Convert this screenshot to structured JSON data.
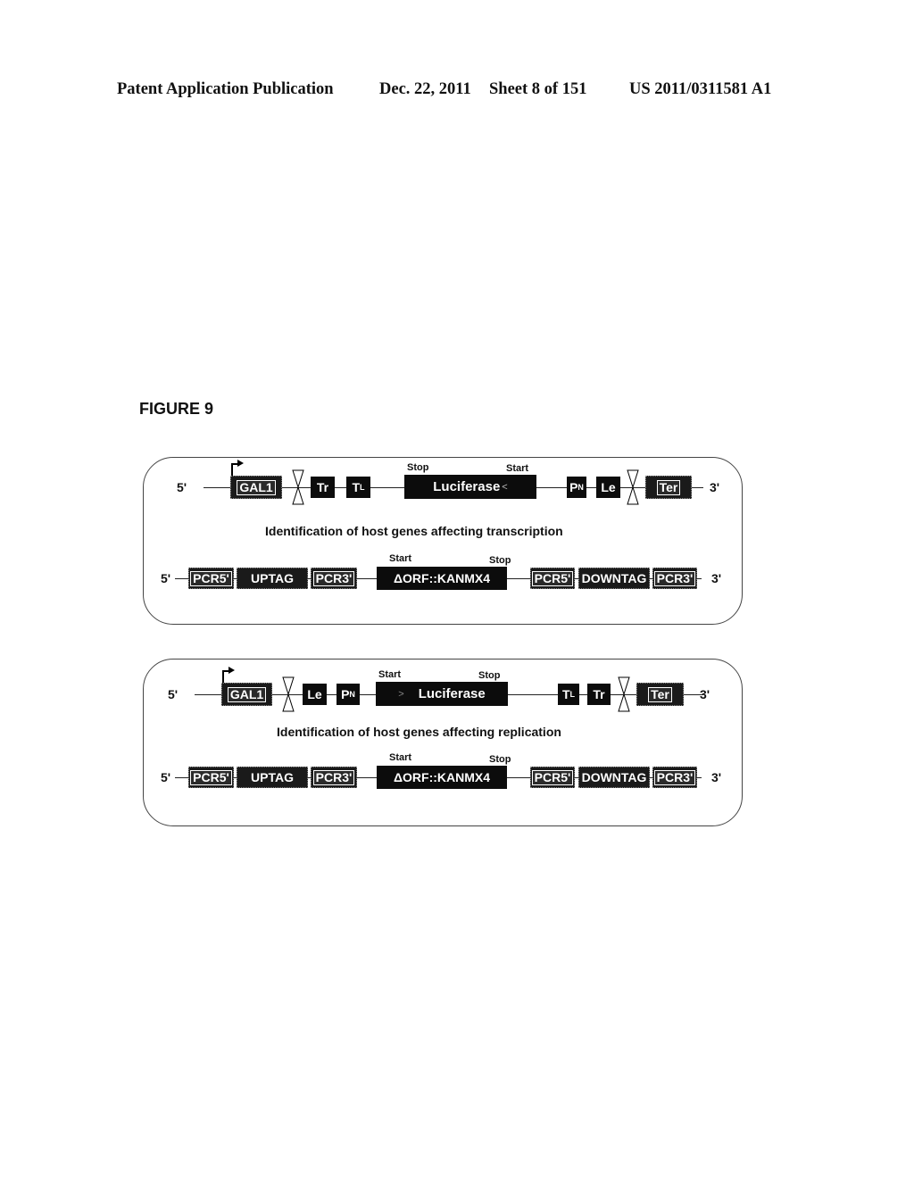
{
  "header": {
    "publication": "Patent Application Publication",
    "date": "Dec. 22, 2011",
    "sheet": "Sheet 8 of 151",
    "number": "US 2011/0311581 A1"
  },
  "figure": {
    "title": "FIGURE 9"
  },
  "panels": [
    {
      "caption": "Identification of host genes affecting transcription",
      "construct": {
        "five_prime": "5'",
        "three_prime": "3'",
        "promoter": "GAL1",
        "elements": [
          "Tr",
          "T",
          "Luciferase",
          "P",
          "Le",
          "Ter"
        ],
        "tl_sub": "L",
        "pn_sub": "N",
        "luciferase_start": "Start",
        "luciferase_stop": "Stop",
        "luciferase_arrow": "<"
      },
      "deletion": {
        "five_prime": "5'",
        "three_prime": "3'",
        "elements": [
          "PCR5'",
          "UPTAG",
          "PCR3'",
          "ΔORF::KANMX4",
          "PCR5'",
          "DOWNTAG",
          "PCR3'"
        ],
        "orf_start": "Start",
        "orf_stop": "Stop"
      }
    },
    {
      "caption": "Identification of host genes affecting replication",
      "construct": {
        "five_prime": "5'",
        "three_prime": "3'",
        "promoter": "GAL1",
        "elements": [
          "Le",
          "P",
          "Luciferase",
          "T",
          "Tr",
          "Ter"
        ],
        "tl_sub": "L",
        "pn_sub": "N",
        "luciferase_start": "Start",
        "luciferase_stop": "Stop",
        "luciferase_arrow": ">"
      },
      "deletion": {
        "five_prime": "5'",
        "three_prime": "3'",
        "elements": [
          "PCR5'",
          "UPTAG",
          "PCR3'",
          "ΔORF::KANMX4",
          "PCR5'",
          "DOWNTAG",
          "PCR3'"
        ],
        "orf_start": "Start",
        "orf_stop": "Stop"
      }
    }
  ]
}
